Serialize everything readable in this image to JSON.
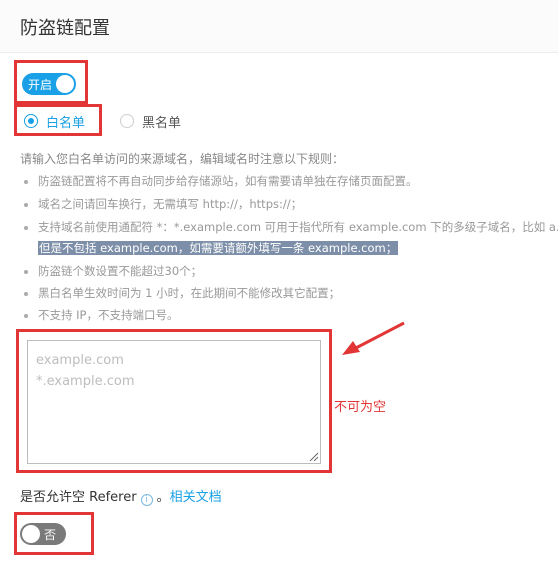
{
  "header": {
    "title": "防盗链配置"
  },
  "enable_toggle": {
    "label": "开启",
    "state": "on"
  },
  "mode": {
    "whitelist_label": "白名单",
    "blacklist_label": "黑名单",
    "selected": "whitelist"
  },
  "tips": {
    "intro": "请输入您白名单访问的来源域名，编辑域名时注意以下规则：",
    "rules": [
      "防盗链配置将不再自动同步给存储源站，如有需要请单独在存储页面配置。",
      "域名之间请回车换行，无需填写 http://，https://；",
      "支持域名前使用通配符 *：*.example.com 可用于指代所有 example.com 下的多级子域名，比如 a.e",
      "但是不包括 example.com，如需要请额外填写一条 example.com；",
      "防盗链个数设置不能超过30个；",
      "黑白名单生效时间为 1 小时，在此期间不能修改其它配置；",
      "不支持 IP，不支持端口号。"
    ]
  },
  "domain_input": {
    "placeholder": "example.com\n*.example.com",
    "value": ""
  },
  "annotation": {
    "warning": "不可为空"
  },
  "referer": {
    "label": "是否允许空 Referer",
    "info_glyph": "i",
    "period": "。",
    "doc_link": "相关文档"
  },
  "empty_referer_toggle": {
    "label": "否",
    "state": "off"
  },
  "colors": {
    "accent": "#1aa0e6",
    "annotation_red": "#e23636",
    "toggle_off": "#7a7a7a"
  }
}
